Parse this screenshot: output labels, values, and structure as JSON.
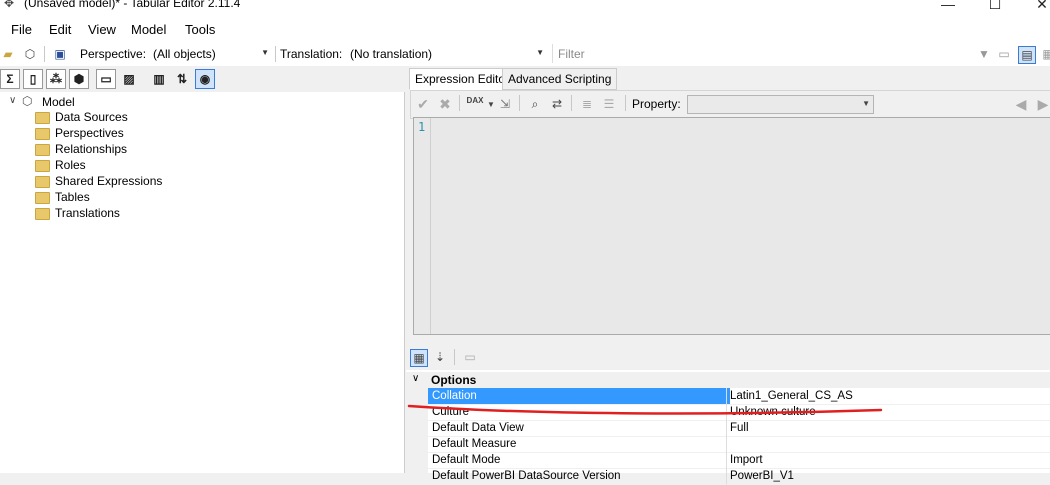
{
  "window": {
    "title": "(Unsaved model)* - Tabular Editor 2.11.4"
  },
  "menu": [
    "File",
    "Edit",
    "View",
    "Model",
    "Tools"
  ],
  "toolbar": {
    "perspective_label": "Perspective:",
    "perspective_value": "(All objects)",
    "translation_label": "Translation:",
    "translation_value": "(No translation)",
    "filter_placeholder": "Filter"
  },
  "tree": {
    "root": "Model",
    "items": [
      "Data Sources",
      "Perspectives",
      "Relationships",
      "Roles",
      "Shared Expressions",
      "Tables",
      "Translations"
    ]
  },
  "tabs": [
    "Expression Editor",
    "Advanced Scripting"
  ],
  "editor": {
    "property_label": "Property:",
    "line_number": "1",
    "dax_label": "DAX"
  },
  "properties": {
    "category": "Options",
    "rows": [
      {
        "name": "Collation",
        "value": "Latin1_General_CS_AS"
      },
      {
        "name": "Culture",
        "value": "Unknown culture"
      },
      {
        "name": "Default Data View",
        "value": "Full"
      },
      {
        "name": "Default Measure",
        "value": ""
      },
      {
        "name": "Default Mode",
        "value": "Import"
      },
      {
        "name": "Default PowerBI DataSource Version",
        "value": "PowerBI_V1"
      }
    ]
  },
  "colors": {
    "selection": "#3399ff",
    "annotation": "#e02020",
    "accent": "#3a7bd5"
  }
}
